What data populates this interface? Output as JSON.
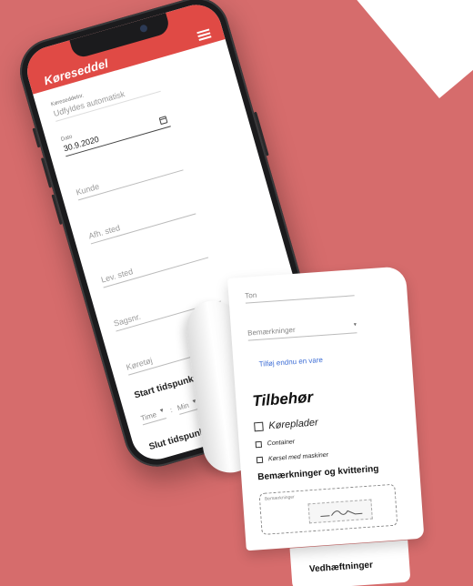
{
  "app": {
    "title": "Køreseddel",
    "menu_icon": "hamburger-menu-icon",
    "accent_color": "#e04a45"
  },
  "form": {
    "kor_nr_label": "Køreseddelnr.",
    "kor_nr_placeholder": "Udfyldes automatisk",
    "date_label": "Dato",
    "date_value": "30.9.2020",
    "kunde_placeholder": "Kunde",
    "afh_sted_placeholder": "Afh. sted",
    "lev_sted_placeholder": "Lev. sted",
    "sagsnr_placeholder": "Sagsnr.",
    "koretoj_placeholder": "Køretøj",
    "start_title": "Start tidspunkt",
    "slut_title": "Slut tidspunkt",
    "hour_label": "Time",
    "minute_label": "Min"
  },
  "receipt": {
    "ton_placeholder": "Ton",
    "remarks_select": "Bemærkninger",
    "add_item_link": "Tilføj endnu en vare",
    "accessories_title": "Tilbehør",
    "checkbox_korepladder": "Køreplader",
    "checkbox_container": "Container",
    "checkbox_korsel": "Kørsel med maskiner",
    "remarks_section_title": "Bemærkninger og kvittering",
    "remarks_label": "Bemærkninger",
    "attachments_title": "Vedhæftninger"
  },
  "colors": {
    "background": "#d66c6c",
    "link": "#3f6fd6"
  }
}
